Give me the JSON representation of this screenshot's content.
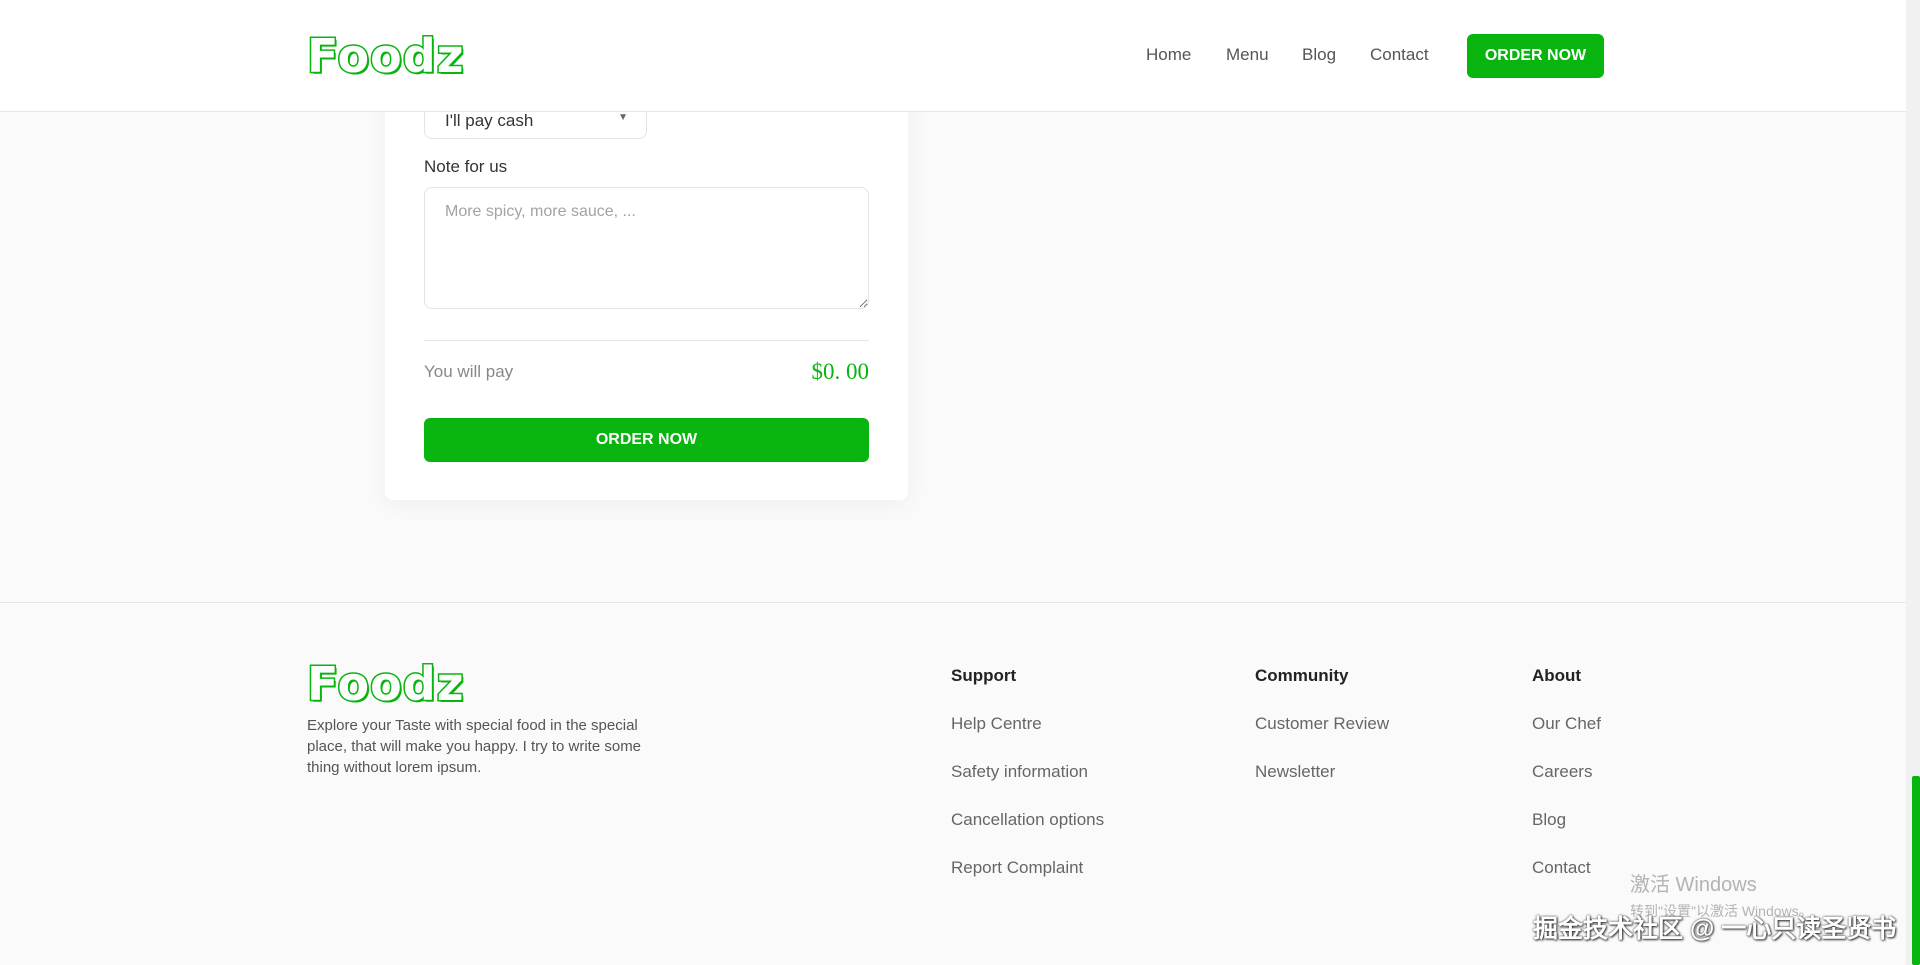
{
  "brand": {
    "name": "Foodz",
    "accent": "#08b40e"
  },
  "nav": {
    "items": [
      "Home",
      "Menu",
      "Blog",
      "Contact"
    ],
    "cta": "ORDER NOW"
  },
  "order_form": {
    "payment_value": "I'll pay cash",
    "note_label": "Note for us",
    "note_placeholder": "More spicy, more sauce, ...",
    "pay_label": "You will pay",
    "pay_amount": "$0. 00",
    "submit_label": "ORDER NOW"
  },
  "footer": {
    "description": "Explore your Taste with special food in the special place, that will make you happy. I try to write some thing without lorem ipsum.",
    "columns": [
      {
        "title": "Support",
        "links": [
          "Help Centre",
          "Safety information",
          "Cancellation options",
          "Report Complaint"
        ]
      },
      {
        "title": "Community",
        "links": [
          "Customer Review",
          "Newsletter"
        ]
      },
      {
        "title": "About",
        "links": [
          "Our Chef",
          "Careers",
          "Blog",
          "Contact"
        ]
      }
    ]
  },
  "overlay": {
    "activate_title": "激活 Windows",
    "activate_sub": "转到\"设置\"以激活 Windows。",
    "watermark": "掘金技术社区 @ 一心只读圣贤书"
  }
}
